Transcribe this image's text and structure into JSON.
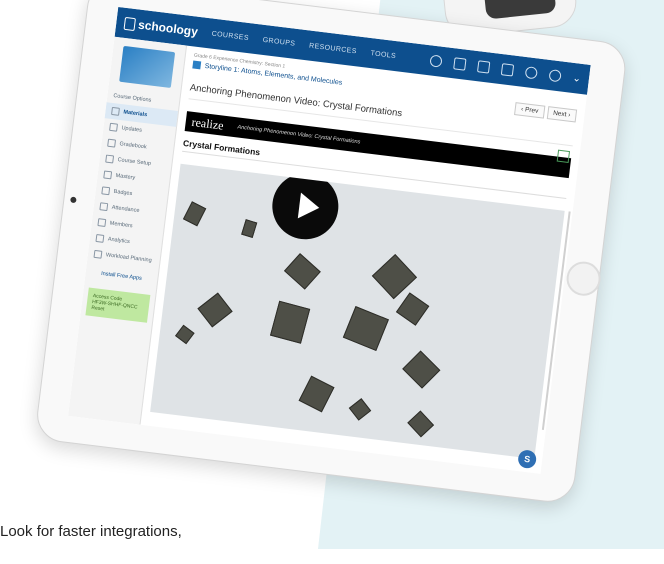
{
  "caption": "Look for faster integrations,",
  "topbar": {
    "logo": "schoology",
    "nav": [
      "COURSES",
      "GROUPS",
      "RESOURCES",
      "TOOLS"
    ],
    "icons": [
      "search-icon",
      "grid-icon",
      "calendar-icon",
      "mail-icon",
      "bell-icon",
      "avatar-icon"
    ]
  },
  "sidebar": {
    "course_options": "Course Options",
    "items": [
      "Materials",
      "Updates",
      "Gradebook",
      "Course Setup",
      "Mastery",
      "Badges",
      "Attendance",
      "Members",
      "Analytics",
      "Workload Planning"
    ],
    "install": "Install Free Apps",
    "access_title": "Access Code",
    "access_code": "HF3W-SHHF-QNCC",
    "access_reset": "Reset"
  },
  "main": {
    "breadcrumb": "Grade 6 Experience Chemistry: Section 1",
    "unit": "Storyline 1: Atoms, Elements, and Molecules",
    "prev": "‹ Prev",
    "next": "Next ›",
    "title": "Anchoring Phenomenon Video: Crystal Formations",
    "realize_brand": "realize",
    "realize_sub": "Anchoring Phenomenon Video: Crystal Formations",
    "video_title": "Crystal Formations",
    "chat_initial": "S"
  },
  "colors": {
    "accent": "#0d4f8e",
    "band": "#e3f2f5"
  }
}
